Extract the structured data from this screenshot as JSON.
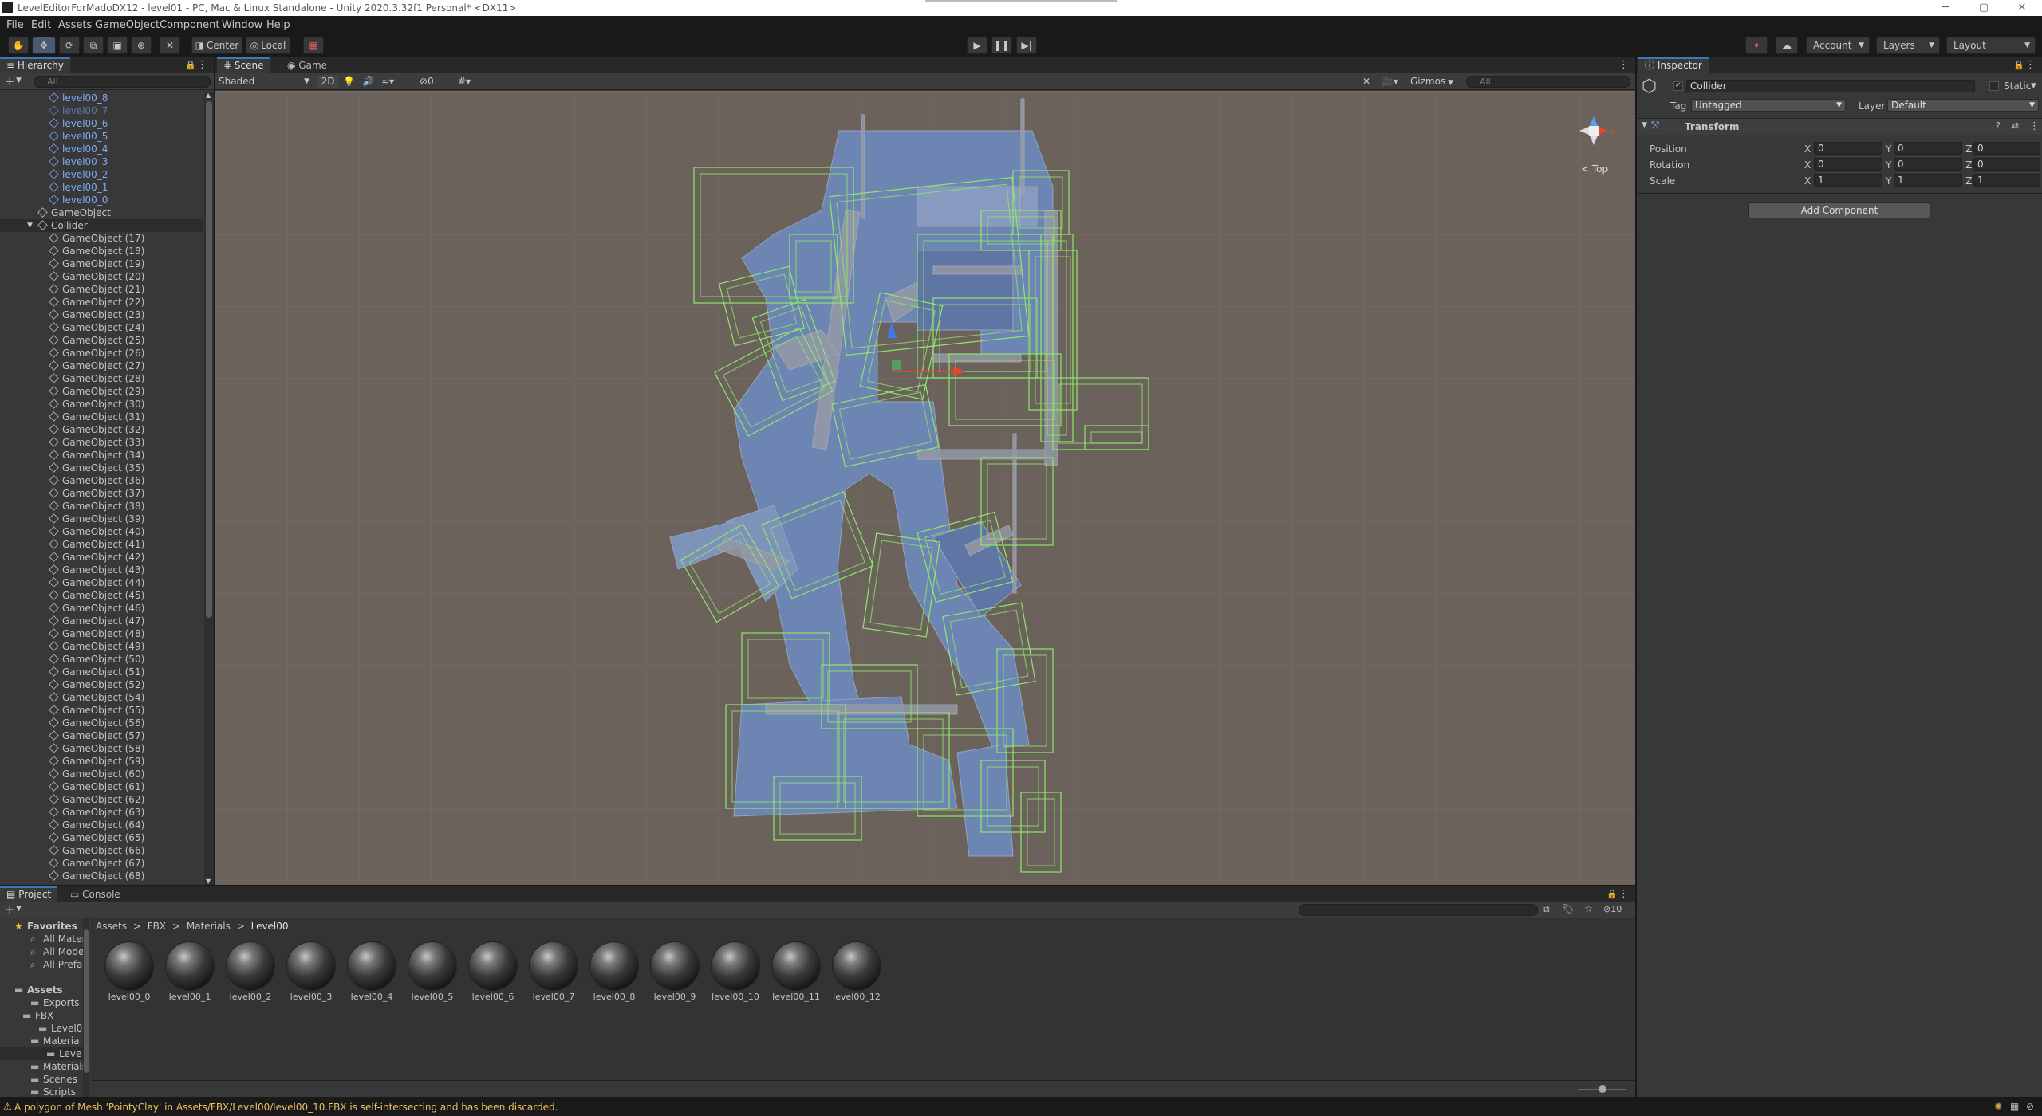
{
  "window": {
    "title": "LevelEditorForMadoDX12 - level01 - PC, Mac & Linux Standalone - Unity 2020.3.32f1 Personal* <DX11>",
    "min": "─",
    "max": "▢",
    "close": "✕"
  },
  "menu": [
    "File",
    "Edit",
    "Assets",
    "GameObject",
    "Component",
    "Window",
    "Help"
  ],
  "toolbar": {
    "pivot": "Center",
    "space": "Local",
    "account": "Account",
    "layers": "Layers",
    "layout": "Layout"
  },
  "hierarchy": {
    "tab": "Hierarchy",
    "add": "+",
    "search_placeholder": "All",
    "items": [
      {
        "label": "level00_8",
        "indent": 3,
        "color": "#7cacf8"
      },
      {
        "label": "level00_7",
        "indent": 3,
        "color": "#5a7bb0"
      },
      {
        "label": "level00_6",
        "indent": 3,
        "color": "#7cacf8"
      },
      {
        "label": "level00_5",
        "indent": 3,
        "color": "#7cacf8"
      },
      {
        "label": "level00_4",
        "indent": 3,
        "color": "#7cacf8"
      },
      {
        "label": "level00_3",
        "indent": 3,
        "color": "#7cacf8"
      },
      {
        "label": "level00_2",
        "indent": 3,
        "color": "#7cacf8"
      },
      {
        "label": "level00_1",
        "indent": 3,
        "color": "#7cacf8"
      },
      {
        "label": "level00_0",
        "indent": 3,
        "color": "#7cacf8"
      },
      {
        "label": "GameObject",
        "indent": 2,
        "color": "#c4c4c4"
      },
      {
        "label": "Collider",
        "indent": 2,
        "color": "#c4c4c4",
        "expanded": true,
        "selected": true
      },
      {
        "label": "GameObject (17)",
        "indent": 3,
        "color": "#c4c4c4"
      },
      {
        "label": "GameObject (18)",
        "indent": 3,
        "color": "#c4c4c4"
      },
      {
        "label": "GameObject (19)",
        "indent": 3,
        "color": "#c4c4c4"
      },
      {
        "label": "GameObject (20)",
        "indent": 3,
        "color": "#c4c4c4"
      },
      {
        "label": "GameObject (21)",
        "indent": 3,
        "color": "#c4c4c4"
      },
      {
        "label": "GameObject (22)",
        "indent": 3,
        "color": "#c4c4c4"
      },
      {
        "label": "GameObject (23)",
        "indent": 3,
        "color": "#c4c4c4"
      },
      {
        "label": "GameObject (24)",
        "indent": 3,
        "color": "#c4c4c4"
      },
      {
        "label": "GameObject (25)",
        "indent": 3,
        "color": "#c4c4c4"
      },
      {
        "label": "GameObject (26)",
        "indent": 3,
        "color": "#c4c4c4"
      },
      {
        "label": "GameObject (27)",
        "indent": 3,
        "color": "#c4c4c4"
      },
      {
        "label": "GameObject (28)",
        "indent": 3,
        "color": "#c4c4c4"
      },
      {
        "label": "GameObject (29)",
        "indent": 3,
        "color": "#c4c4c4"
      },
      {
        "label": "GameObject (30)",
        "indent": 3,
        "color": "#c4c4c4"
      },
      {
        "label": "GameObject (31)",
        "indent": 3,
        "color": "#c4c4c4"
      },
      {
        "label": "GameObject (32)",
        "indent": 3,
        "color": "#c4c4c4"
      },
      {
        "label": "GameObject (33)",
        "indent": 3,
        "color": "#c4c4c4"
      },
      {
        "label": "GameObject (34)",
        "indent": 3,
        "color": "#c4c4c4"
      },
      {
        "label": "GameObject (35)",
        "indent": 3,
        "color": "#c4c4c4"
      },
      {
        "label": "GameObject (36)",
        "indent": 3,
        "color": "#c4c4c4"
      },
      {
        "label": "GameObject (37)",
        "indent": 3,
        "color": "#c4c4c4"
      },
      {
        "label": "GameObject (38)",
        "indent": 3,
        "color": "#c4c4c4"
      },
      {
        "label": "GameObject (39)",
        "indent": 3,
        "color": "#c4c4c4"
      },
      {
        "label": "GameObject (40)",
        "indent": 3,
        "color": "#c4c4c4"
      },
      {
        "label": "GameObject (41)",
        "indent": 3,
        "color": "#c4c4c4"
      },
      {
        "label": "GameObject (42)",
        "indent": 3,
        "color": "#c4c4c4"
      },
      {
        "label": "GameObject (43)",
        "indent": 3,
        "color": "#c4c4c4"
      },
      {
        "label": "GameObject (44)",
        "indent": 3,
        "color": "#c4c4c4"
      },
      {
        "label": "GameObject (45)",
        "indent": 3,
        "color": "#c4c4c4"
      },
      {
        "label": "GameObject (46)",
        "indent": 3,
        "color": "#c4c4c4"
      },
      {
        "label": "GameObject (47)",
        "indent": 3,
        "color": "#c4c4c4"
      },
      {
        "label": "GameObject (48)",
        "indent": 3,
        "color": "#c4c4c4"
      },
      {
        "label": "GameObject (49)",
        "indent": 3,
        "color": "#c4c4c4"
      },
      {
        "label": "GameObject (50)",
        "indent": 3,
        "color": "#c4c4c4"
      },
      {
        "label": "GameObject (51)",
        "indent": 3,
        "color": "#c4c4c4"
      },
      {
        "label": "GameObject (52)",
        "indent": 3,
        "color": "#c4c4c4"
      },
      {
        "label": "GameObject (54)",
        "indent": 3,
        "color": "#c4c4c4"
      },
      {
        "label": "GameObject (55)",
        "indent": 3,
        "color": "#c4c4c4"
      },
      {
        "label": "GameObject (56)",
        "indent": 3,
        "color": "#c4c4c4"
      },
      {
        "label": "GameObject (57)",
        "indent": 3,
        "color": "#c4c4c4"
      },
      {
        "label": "GameObject (58)",
        "indent": 3,
        "color": "#c4c4c4"
      },
      {
        "label": "GameObject (59)",
        "indent": 3,
        "color": "#c4c4c4"
      },
      {
        "label": "GameObject (60)",
        "indent": 3,
        "color": "#c4c4c4"
      },
      {
        "label": "GameObject (61)",
        "indent": 3,
        "color": "#c4c4c4"
      },
      {
        "label": "GameObject (62)",
        "indent": 3,
        "color": "#c4c4c4"
      },
      {
        "label": "GameObject (63)",
        "indent": 3,
        "color": "#c4c4c4"
      },
      {
        "label": "GameObject (64)",
        "indent": 3,
        "color": "#c4c4c4"
      },
      {
        "label": "GameObject (65)",
        "indent": 3,
        "color": "#c4c4c4"
      },
      {
        "label": "GameObject (66)",
        "indent": 3,
        "color": "#c4c4c4"
      },
      {
        "label": "GameObject (67)",
        "indent": 3,
        "color": "#c4c4c4"
      },
      {
        "label": "GameObject (68)",
        "indent": 3,
        "color": "#c4c4c4"
      }
    ]
  },
  "scene": {
    "tabs": [
      "Scene",
      "Game"
    ],
    "shading": "Shaded",
    "mode_2d": "2D",
    "hidden_count": "0",
    "gizmos": "Gizmos",
    "search_placeholder": "All",
    "gizmo_label": "< Top",
    "colors": {
      "background": "#6b625c",
      "mesh": "#6d87b8",
      "wire": "#8ee86a"
    }
  },
  "inspector": {
    "tab": "Inspector",
    "object_name": "Collider",
    "static": "Static",
    "tag_label": "Tag",
    "tag_value": "Untagged",
    "layer_label": "Layer",
    "layer_value": "Default",
    "component": "Transform",
    "position": {
      "label": "Position",
      "x": "0",
      "y": "0",
      "z": "0"
    },
    "rotation": {
      "label": "Rotation",
      "x": "0",
      "y": "0",
      "z": "0"
    },
    "scale": {
      "label": "Scale",
      "x": "1",
      "y": "1",
      "z": "1"
    },
    "axis_x": "X",
    "axis_y": "Y",
    "axis_z": "Z",
    "add_component": "Add Component"
  },
  "project": {
    "tabs": [
      "Project",
      "Console"
    ],
    "hidden_count": "10",
    "breadcrumb": [
      "Assets",
      "FBX",
      "Materials",
      "Level00"
    ],
    "breadcrumb_sep": ">",
    "tree": [
      {
        "label": "Favorites",
        "indent": 0,
        "bold": true,
        "icon": "star"
      },
      {
        "label": "All Materi",
        "indent": 2,
        "icon": "search"
      },
      {
        "label": "All Model",
        "indent": 2,
        "icon": "search"
      },
      {
        "label": "All Prefab",
        "indent": 2,
        "icon": "search"
      },
      {
        "label": "",
        "indent": 0,
        "icon": "none"
      },
      {
        "label": "Assets",
        "indent": 0,
        "bold": true,
        "icon": "folder"
      },
      {
        "label": "Exports",
        "indent": 2,
        "icon": "folder"
      },
      {
        "label": "FBX",
        "indent": 1,
        "icon": "folder"
      },
      {
        "label": "Level0",
        "indent": 3,
        "icon": "folder"
      },
      {
        "label": "Materia",
        "indent": 2,
        "icon": "folder"
      },
      {
        "label": "Leve",
        "indent": 4,
        "icon": "folder",
        "selected": true
      },
      {
        "label": "Materials",
        "indent": 2,
        "icon": "folder"
      },
      {
        "label": "Scenes",
        "indent": 2,
        "icon": "folder"
      },
      {
        "label": "Scripts",
        "indent": 2,
        "icon": "folder"
      }
    ],
    "assets": [
      "level00_0",
      "level00_1",
      "level00_2",
      "level00_3",
      "level00_4",
      "level00_5",
      "level00_6",
      "level00_7",
      "level00_8",
      "level00_9",
      "level00_10",
      "level00_11",
      "level00_12"
    ]
  },
  "status": {
    "message": "A polygon of Mesh 'PointyClay' in Assets/FBX/Level00/level00_10.FBX is self-intersecting and has been discarded.",
    "warning_color": "#f0c060"
  }
}
